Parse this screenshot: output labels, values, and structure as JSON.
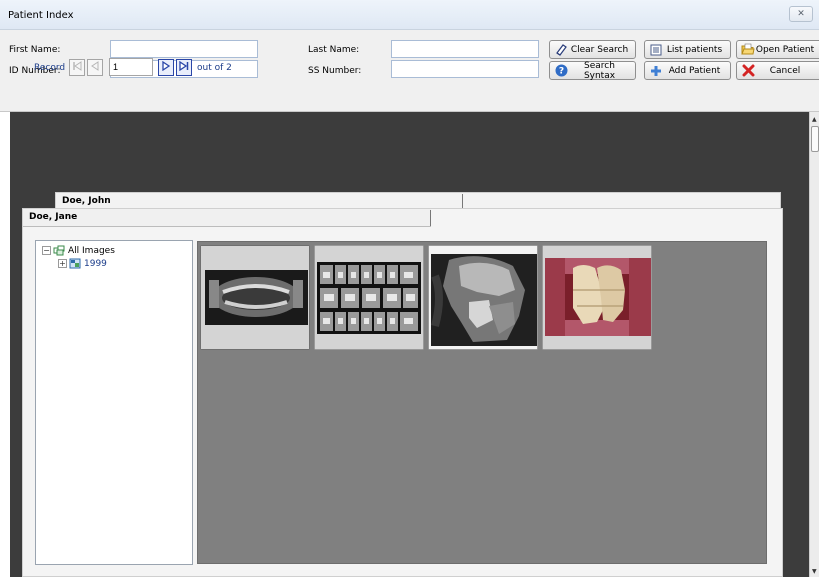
{
  "window": {
    "title": "Patient Index",
    "close_glyph": "✕"
  },
  "search": {
    "first_name_label": "First Name:",
    "first_name_value": "",
    "id_number_label": "ID Number:",
    "id_number_value": "",
    "last_name_label": "Last Name:",
    "last_name_value": "",
    "ss_number_label": "SS Number:",
    "ss_number_value": ""
  },
  "buttons": {
    "clear_search": "Clear Search",
    "search_syntax": "Search Syntax",
    "list_patients": "List patients",
    "add_patient": "Add Patient",
    "open_patient": "Open Patient",
    "cancel": "Cancel"
  },
  "record_nav": {
    "label": "Record",
    "current": "1",
    "out_of": "out of 2"
  },
  "patients": {
    "back_card_name": "Doe, John",
    "front_card_name": "Doe, Jane"
  },
  "tree": {
    "root_label": "All Images",
    "child_label": "1999",
    "expand_glyph_root": "−",
    "expand_glyph_child": "+"
  },
  "images": [
    {
      "name": "panoramic-xray",
      "kind": "panoramic x-ray"
    },
    {
      "name": "bitewing-series",
      "kind": "full-mouth x-ray series"
    },
    {
      "name": "cephalometric-xray",
      "kind": "cephalometric x-ray"
    },
    {
      "name": "intraoral-photo",
      "kind": "intraoral photo"
    }
  ],
  "colors": {
    "workspace_bg": "#3c3c3c",
    "thumb_panel_bg": "#808080",
    "link_blue": "#1c3d8a"
  },
  "icons": {
    "clear_search": "eraser-icon",
    "search_syntax": "help-icon",
    "list_patients": "list-icon",
    "add_patient": "plus-icon",
    "open_patient": "folder-open-icon",
    "cancel": "cancel-x-icon"
  }
}
